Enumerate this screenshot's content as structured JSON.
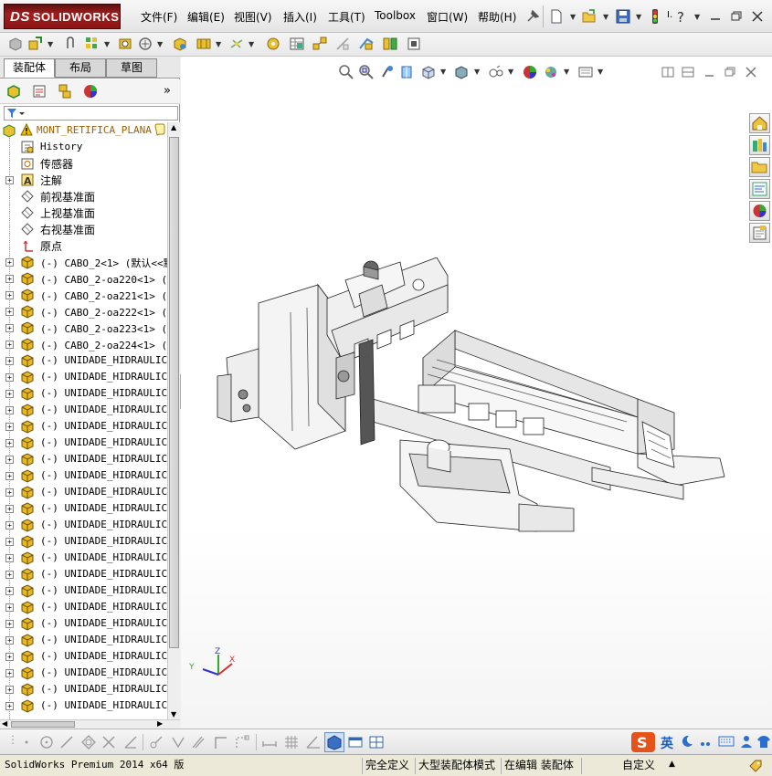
{
  "app": {
    "logo_text": "SOLIDWORKS",
    "logo_ds": "DS"
  },
  "menu": {
    "items": [
      "文件(F)",
      "编辑(E)",
      "视图(V)",
      "插入(I)",
      "工具(T)",
      "Toolbox",
      "窗口(W)",
      "帮助(H)"
    ],
    "overflow_label": "I."
  },
  "left_panel": {
    "tabs": [
      "装配体",
      "布局",
      "草图"
    ],
    "active_tab": 0,
    "tree": {
      "root": "MONT_RETIFICA_PLANA",
      "items": [
        {
          "label": "History",
          "type": "history",
          "expandable": false
        },
        {
          "label": "传感器",
          "type": "sensor",
          "expandable": false
        },
        {
          "label": "注解",
          "type": "annotation",
          "expandable": true
        },
        {
          "label": "前视基准面",
          "type": "plane",
          "expandable": false
        },
        {
          "label": "上视基准面",
          "type": "plane",
          "expandable": false
        },
        {
          "label": "右视基准面",
          "type": "plane",
          "expandable": false
        },
        {
          "label": "原点",
          "type": "origin",
          "expandable": false
        },
        {
          "label": "(-) CABO_2<1> (默认<<默",
          "type": "part",
          "expandable": true
        },
        {
          "label": "(-) CABO_2-oa220<1> (默",
          "type": "part",
          "expandable": true
        },
        {
          "label": "(-) CABO_2-oa221<1> (默",
          "type": "part",
          "expandable": true
        },
        {
          "label": "(-) CABO_2-oa222<1> (默",
          "type": "part",
          "expandable": true
        },
        {
          "label": "(-) CABO_2-oa223<1> (默",
          "type": "part",
          "expandable": true
        },
        {
          "label": "(-) CABO_2-oa224<1> (默",
          "type": "part",
          "expandable": true
        },
        {
          "label": "(-) UNIDADE_HIDRAULICA_",
          "type": "part",
          "expandable": true
        },
        {
          "label": "(-) UNIDADE_HIDRAULICA_",
          "type": "part",
          "expandable": true
        },
        {
          "label": "(-) UNIDADE_HIDRAULICA_",
          "type": "part",
          "expandable": true
        },
        {
          "label": "(-) UNIDADE_HIDRAULICA_",
          "type": "part",
          "expandable": true
        },
        {
          "label": "(-) UNIDADE_HIDRAULICA_",
          "type": "part",
          "expandable": true
        },
        {
          "label": "(-) UNIDADE_HIDRAULICA_",
          "type": "part",
          "expandable": true
        },
        {
          "label": "(-) UNIDADE_HIDRAULICA_",
          "type": "part",
          "expandable": true
        },
        {
          "label": "(-) UNIDADE_HIDRAULICA_",
          "type": "part",
          "expandable": true
        },
        {
          "label": "(-) UNIDADE_HIDRAULICA_",
          "type": "part",
          "expandable": true
        },
        {
          "label": "(-) UNIDADE_HIDRAULICA_",
          "type": "part",
          "expandable": true
        },
        {
          "label": "(-) UNIDADE_HIDRAULICA_",
          "type": "part",
          "expandable": true
        },
        {
          "label": "(-) UNIDADE_HIDRAULICA_",
          "type": "part",
          "expandable": true
        },
        {
          "label": "(-) UNIDADE_HIDRAULICA_",
          "type": "part",
          "expandable": true
        },
        {
          "label": "(-) UNIDADE_HIDRAULICA_",
          "type": "part",
          "expandable": true
        },
        {
          "label": "(-) UNIDADE_HIDRAULICA_",
          "type": "part",
          "expandable": true
        },
        {
          "label": "(-) UNIDADE_HIDRAULICA_",
          "type": "part",
          "expandable": true
        },
        {
          "label": "(-) UNIDADE_HIDRAULICA_",
          "type": "part",
          "expandable": true
        },
        {
          "label": "(-) UNIDADE_HIDRAULICA_",
          "type": "part",
          "expandable": true
        },
        {
          "label": "(-) UNIDADE_HIDRAULICA_",
          "type": "part",
          "expandable": true
        },
        {
          "label": "(-) UNIDADE_HIDRAULICA_",
          "type": "part",
          "expandable": true
        },
        {
          "label": "(-) UNIDADE_HIDRAULICA_",
          "type": "part",
          "expandable": true
        },
        {
          "label": "(-) UNIDADE_HIDRAULICA_",
          "type": "part",
          "expandable": true
        }
      ]
    }
  },
  "graphics": {
    "triad": {
      "x": "X",
      "y": "Y",
      "z": "Z"
    }
  },
  "ime": {
    "mode": "英"
  },
  "status_bar": {
    "product": "SolidWorks Premium 2014 x64 版",
    "definition": "完全定义",
    "mode": "大型装配体模式",
    "editing": "在编辑 装配体",
    "units": "自定义"
  },
  "colors": {
    "logo_red": "#a51c1c",
    "warning_yellow": "#f0c000",
    "part_yellow": "#e8b820"
  }
}
